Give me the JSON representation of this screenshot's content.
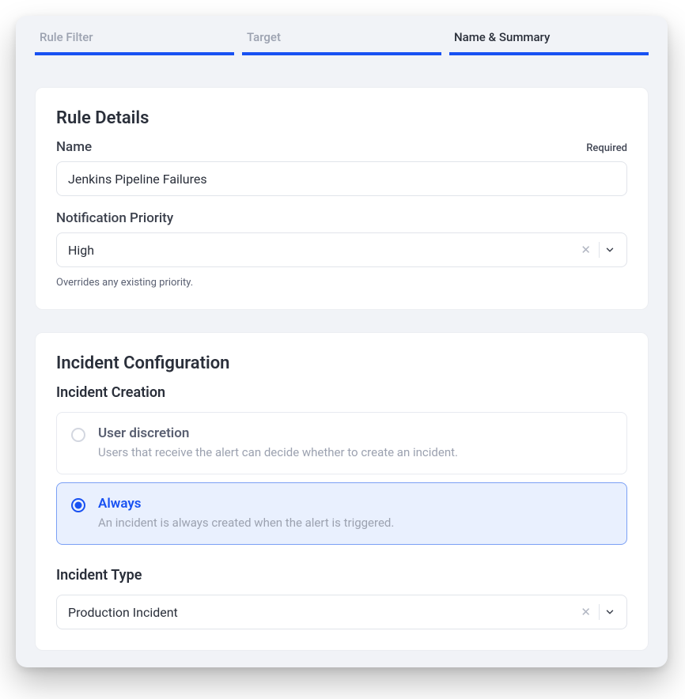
{
  "tabs": [
    {
      "label": "Rule Filter"
    },
    {
      "label": "Target"
    },
    {
      "label": "Name & Summary"
    }
  ],
  "ruleDetails": {
    "heading": "Rule Details",
    "name": {
      "label": "Name",
      "required": "Required",
      "value": "Jenkins Pipeline Failures"
    },
    "priority": {
      "label": "Notification Priority",
      "value": "High",
      "hint": "Overrides any existing priority."
    }
  },
  "incidentConfig": {
    "heading": "Incident Configuration",
    "creation": {
      "label": "Incident Creation",
      "options": [
        {
          "title": "User discretion",
          "desc": "Users that receive the alert can decide whether to create an incident."
        },
        {
          "title": "Always",
          "desc": "An incident is always created when the alert is triggered."
        }
      ]
    },
    "type": {
      "label": "Incident Type",
      "value": "Production Incident"
    }
  }
}
